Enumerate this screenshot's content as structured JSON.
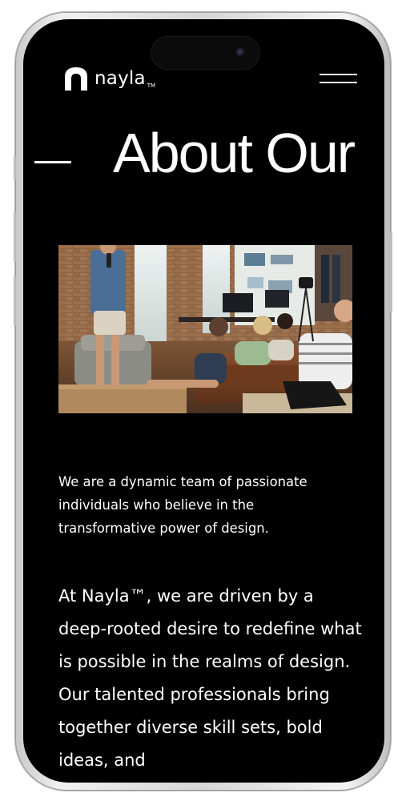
{
  "brand": {
    "name": "nayla",
    "trademark": "TM"
  },
  "header": {
    "menu_icon": "hamburger-menu-icon"
  },
  "hero": {
    "title": "About Our"
  },
  "photo": {
    "subject": "team-meeting-photo"
  },
  "intro": {
    "text": "We are a dynamic team of passionate individuals who believe in the transformative power of design."
  },
  "body": {
    "text": "At Nayla™, we are driven by a deep-rooted desire to redefine what is possible in the realms of design. Our talented professionals bring together diverse skill sets, bold ideas, and"
  },
  "colors": {
    "background": "#000000",
    "text": "#ffffff",
    "frame": "#d9d9d9"
  }
}
